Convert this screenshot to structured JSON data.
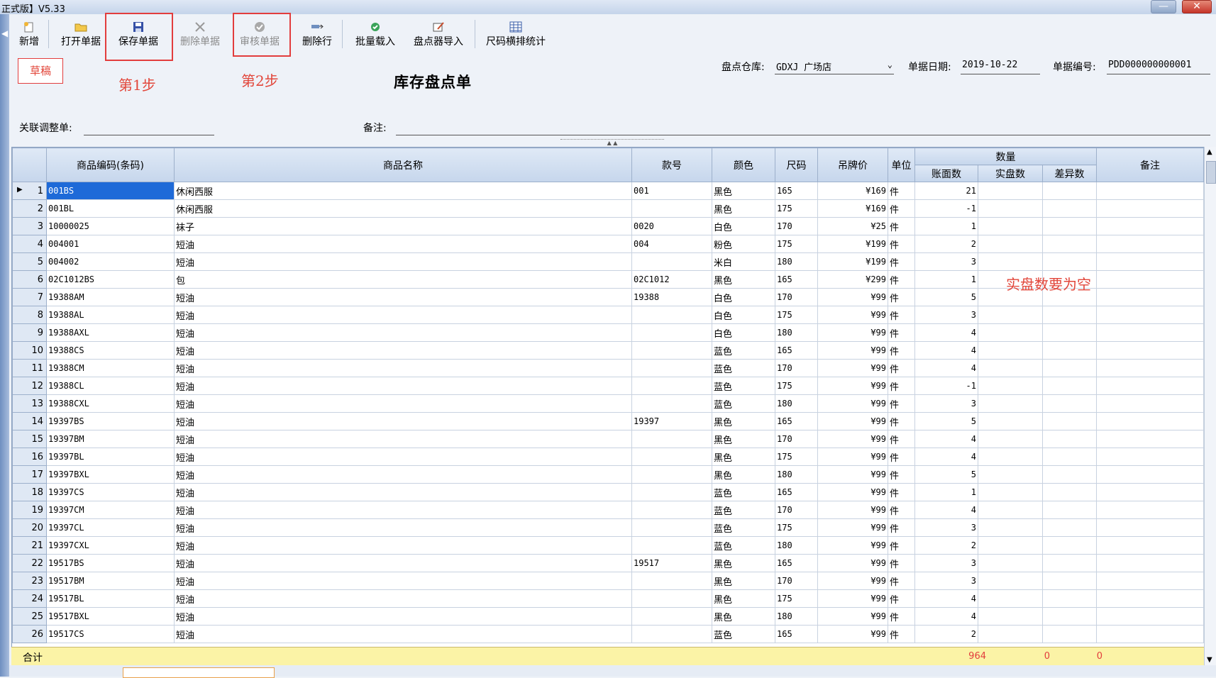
{
  "window": {
    "title": "正式版】V5.33",
    "minimize": "—",
    "close": "✕"
  },
  "toolbar": [
    {
      "label": "新增",
      "icon": "new-doc-icon",
      "enabled": true
    },
    {
      "label": "打开单据",
      "icon": "folder-open-icon",
      "enabled": true
    },
    {
      "label": "保存单据",
      "icon": "save-disk-icon",
      "enabled": true
    },
    {
      "label": "删除单据",
      "icon": "delete-x-icon",
      "enabled": false
    },
    {
      "label": "审核单据",
      "icon": "approve-check-icon",
      "enabled": false
    },
    {
      "label": "删除行",
      "icon": "delete-row-icon",
      "enabled": true
    },
    {
      "label": "批量载入",
      "icon": "batch-load-icon",
      "enabled": true
    },
    {
      "label": "盘点器导入",
      "icon": "scanner-import-icon",
      "enabled": true
    },
    {
      "label": "尺码横排统计",
      "icon": "size-grid-icon",
      "enabled": true
    }
  ],
  "annotations": {
    "step1": "第1步",
    "step2": "第2步",
    "note": "实盘数要为空"
  },
  "status": {
    "draft": "草稿"
  },
  "doc": {
    "title": "库存盘点单"
  },
  "header_fields": {
    "warehouse_label": "盘点仓库:",
    "warehouse_value": "GDXJ 广场店",
    "date_label": "单据日期:",
    "date_value": "2019-10-22",
    "docno_label": "单据编号:",
    "docno_value": "PDD000000000001",
    "linked_label": "关联调整单:",
    "linked_value": "",
    "remark_label": "备注:",
    "remark_value": ""
  },
  "table": {
    "headers": {
      "code": "商品编码(条码)",
      "name": "商品名称",
      "style": "款号",
      "color": "颜色",
      "size": "尺码",
      "price": "吊牌价",
      "unit": "单位",
      "qty_group": "数量",
      "book": "账面数",
      "actual": "实盘数",
      "diff": "差异数",
      "remark": "备注"
    },
    "rows": [
      {
        "no": "1",
        "code": "001BS",
        "name": "休闲西服",
        "style": "001",
        "color": "黑色",
        "size": "165",
        "price": "¥169",
        "unit": "件",
        "book": "21"
      },
      {
        "no": "2",
        "code": "001BL",
        "name": "休闲西服",
        "style": "",
        "color": "黑色",
        "size": "175",
        "price": "¥169",
        "unit": "件",
        "book": "-1"
      },
      {
        "no": "3",
        "code": "10000025",
        "name": "袜子",
        "style": "0020",
        "color": "白色",
        "size": "170",
        "price": "¥25",
        "unit": "件",
        "book": "1"
      },
      {
        "no": "4",
        "code": "004001",
        "name": "短油",
        "style": "004",
        "color": "粉色",
        "size": "175",
        "price": "¥199",
        "unit": "件",
        "book": "2"
      },
      {
        "no": "5",
        "code": "004002",
        "name": "短油",
        "style": "",
        "color": "米白",
        "size": "180",
        "price": "¥199",
        "unit": "件",
        "book": "3"
      },
      {
        "no": "6",
        "code": "02C1012BS",
        "name": "包",
        "style": "02C1012",
        "color": "黑色",
        "size": "165",
        "price": "¥299",
        "unit": "件",
        "book": "1"
      },
      {
        "no": "7",
        "code": "19388AM",
        "name": "短油",
        "style": "19388",
        "color": "白色",
        "size": "170",
        "price": "¥99",
        "unit": "件",
        "book": "5"
      },
      {
        "no": "8",
        "code": "19388AL",
        "name": "短油",
        "style": "",
        "color": "白色",
        "size": "175",
        "price": "¥99",
        "unit": "件",
        "book": "3"
      },
      {
        "no": "9",
        "code": "19388AXL",
        "name": "短油",
        "style": "",
        "color": "白色",
        "size": "180",
        "price": "¥99",
        "unit": "件",
        "book": "4"
      },
      {
        "no": "10",
        "code": "19388CS",
        "name": "短油",
        "style": "",
        "color": "蓝色",
        "size": "165",
        "price": "¥99",
        "unit": "件",
        "book": "4"
      },
      {
        "no": "11",
        "code": "19388CM",
        "name": "短油",
        "style": "",
        "color": "蓝色",
        "size": "170",
        "price": "¥99",
        "unit": "件",
        "book": "4"
      },
      {
        "no": "12",
        "code": "19388CL",
        "name": "短油",
        "style": "",
        "color": "蓝色",
        "size": "175",
        "price": "¥99",
        "unit": "件",
        "book": "-1"
      },
      {
        "no": "13",
        "code": "19388CXL",
        "name": "短油",
        "style": "",
        "color": "蓝色",
        "size": "180",
        "price": "¥99",
        "unit": "件",
        "book": "3"
      },
      {
        "no": "14",
        "code": "19397BS",
        "name": "短油",
        "style": "19397",
        "color": "黑色",
        "size": "165",
        "price": "¥99",
        "unit": "件",
        "book": "5"
      },
      {
        "no": "15",
        "code": "19397BM",
        "name": "短油",
        "style": "",
        "color": "黑色",
        "size": "170",
        "price": "¥99",
        "unit": "件",
        "book": "4"
      },
      {
        "no": "16",
        "code": "19397BL",
        "name": "短油",
        "style": "",
        "color": "黑色",
        "size": "175",
        "price": "¥99",
        "unit": "件",
        "book": "4"
      },
      {
        "no": "17",
        "code": "19397BXL",
        "name": "短油",
        "style": "",
        "color": "黑色",
        "size": "180",
        "price": "¥99",
        "unit": "件",
        "book": "5"
      },
      {
        "no": "18",
        "code": "19397CS",
        "name": "短油",
        "style": "",
        "color": "蓝色",
        "size": "165",
        "price": "¥99",
        "unit": "件",
        "book": "1"
      },
      {
        "no": "19",
        "code": "19397CM",
        "name": "短油",
        "style": "",
        "color": "蓝色",
        "size": "170",
        "price": "¥99",
        "unit": "件",
        "book": "4"
      },
      {
        "no": "20",
        "code": "19397CL",
        "name": "短油",
        "style": "",
        "color": "蓝色",
        "size": "175",
        "price": "¥99",
        "unit": "件",
        "book": "3"
      },
      {
        "no": "21",
        "code": "19397CXL",
        "name": "短油",
        "style": "",
        "color": "蓝色",
        "size": "180",
        "price": "¥99",
        "unit": "件",
        "book": "2"
      },
      {
        "no": "22",
        "code": "19517BS",
        "name": "短油",
        "style": "19517",
        "color": "黑色",
        "size": "165",
        "price": "¥99",
        "unit": "件",
        "book": "3"
      },
      {
        "no": "23",
        "code": "19517BM",
        "name": "短油",
        "style": "",
        "color": "黑色",
        "size": "170",
        "price": "¥99",
        "unit": "件",
        "book": "3"
      },
      {
        "no": "24",
        "code": "19517BL",
        "name": "短油",
        "style": "",
        "color": "黑色",
        "size": "175",
        "price": "¥99",
        "unit": "件",
        "book": "4"
      },
      {
        "no": "25",
        "code": "19517BXL",
        "name": "短油",
        "style": "",
        "color": "黑色",
        "size": "180",
        "price": "¥99",
        "unit": "件",
        "book": "4"
      },
      {
        "no": "26",
        "code": "19517CS",
        "name": "短油",
        "style": "",
        "color": "蓝色",
        "size": "165",
        "price": "¥99",
        "unit": "件",
        "book": "2"
      }
    ],
    "totals": {
      "label": "合计",
      "book": "964",
      "actual": "0",
      "diff": "0"
    }
  },
  "colors": {
    "accent_red": "#e2463a",
    "selection": "#1e6ad8",
    "total_bg": "#fbf3a6"
  }
}
